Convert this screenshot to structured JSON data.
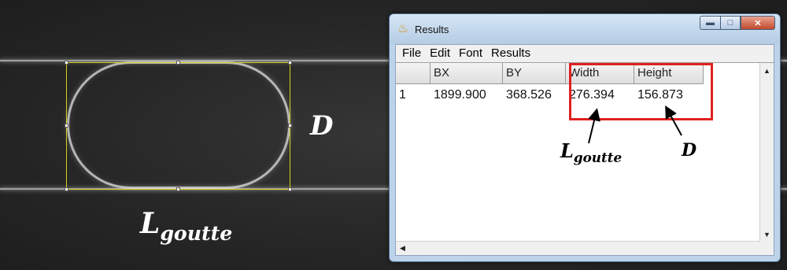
{
  "image_labels": {
    "diameter": "D",
    "length_main": "L",
    "length_sub": "goutte"
  },
  "window": {
    "title": "Results",
    "app_icon": "imagej-icon",
    "controls": [
      "minimize",
      "maximize",
      "close"
    ]
  },
  "menu": [
    "File",
    "Edit",
    "Font",
    "Results"
  ],
  "table": {
    "columns": [
      "",
      "BX",
      "BY",
      "Width",
      "Height"
    ],
    "rows": [
      [
        "1",
        "1899.900",
        "368.526",
        "276.394",
        "156.873"
      ]
    ]
  },
  "annotations": {
    "width_label_main": "L",
    "width_label_sub": "goutte",
    "height_label": "D",
    "highlight_color": "#e02020"
  },
  "colors": {
    "bbox": "#d8d21a",
    "titlebar": "#bcd3ea",
    "close_button": "#c24a2d"
  }
}
